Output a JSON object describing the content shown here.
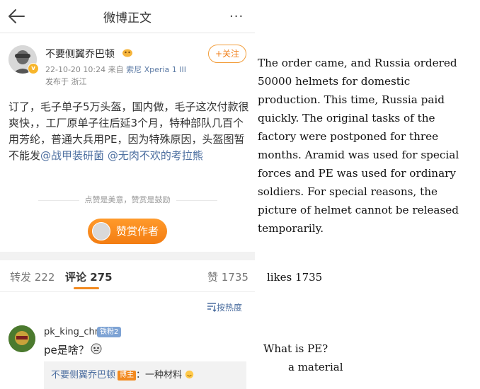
{
  "nav": {
    "title": "微博正文",
    "more": "···"
  },
  "post": {
    "author": "不要侧翼乔巴顿",
    "v_badge": "v",
    "time": "22-10-20 10:24",
    "from_label": "来自",
    "device": "索尼 Xperia 1 III",
    "location": "发布于 浙江",
    "follow_label": "+关注",
    "body_text": "订了，毛子单子5万头盔，国内做，毛子这次付款很爽快，，工厂原单子往后延3个月，特种部队几百个用芳纶，普通大兵用PE，因为特殊原因，头盔图暂不能发",
    "mention1": "@战甲装研菌",
    "mention2": "@无肉不欢的考拉熊"
  },
  "reward": {
    "hint": "点赞是美意，赞赏是鼓励",
    "button": "赞赏作者"
  },
  "tabs": {
    "repost": "转发 222",
    "comment": "评论 275",
    "likes": "赞 1735"
  },
  "sort_label": "按热度",
  "comment": {
    "user": "pk_king_chn",
    "fan_badge": "铁粉2",
    "text": "pe是啥？",
    "reply_user": "不要侧翼乔巴顿",
    "reply_badge": "博主",
    "reply_text": "：一种材料"
  },
  "translation": {
    "post": "The order came, and Russia ordered 50000 helmets for domestic production. This time, Russia paid quickly. The original tasks of the factory were postponed for three months. Aramid was used for special forces and PE was used for ordinary soldiers. For special reasons, the picture of helmet cannot be released temporarily.",
    "likes": "likes 1735",
    "question": "What is PE?",
    "answer": "a material"
  },
  "colors": {
    "accent": "#f28a20",
    "link": "#4d6fa0"
  }
}
